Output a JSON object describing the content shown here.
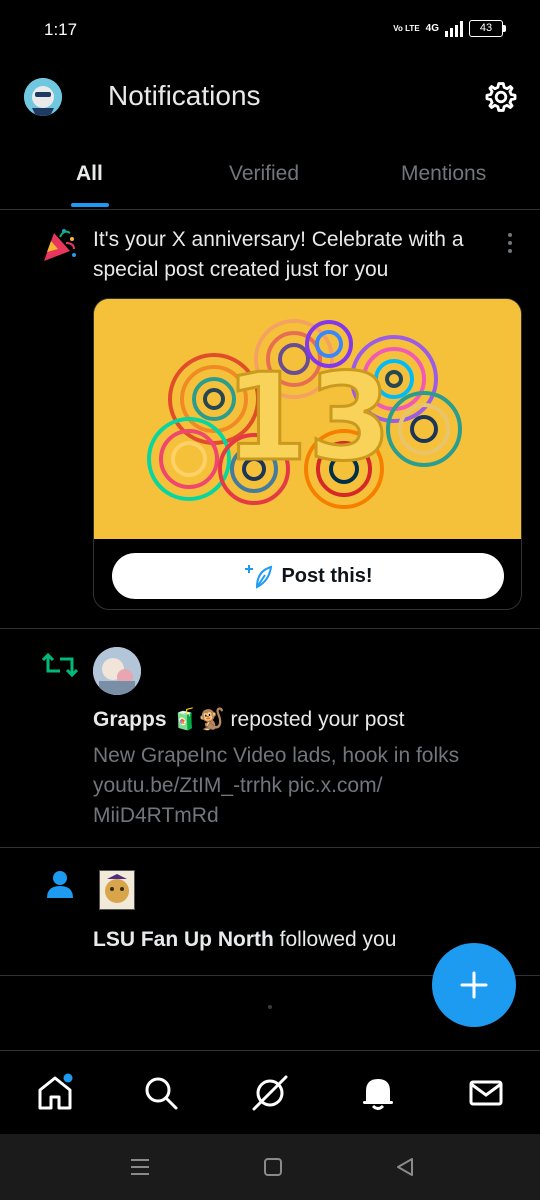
{
  "status_bar": {
    "time": "1:17",
    "volte": "Vo LTE",
    "network": "4G",
    "battery": "43"
  },
  "header": {
    "title": "Notifications"
  },
  "tabs": [
    {
      "label": "All",
      "active": true
    },
    {
      "label": "Verified",
      "active": false
    },
    {
      "label": "Mentions",
      "active": false
    }
  ],
  "anniversary": {
    "line1": "It's your X anniversary! Celebrate with a",
    "line2": "special post created just for you",
    "image_number": "13",
    "post_button": "Post this!"
  },
  "repost": {
    "user": "Grapps",
    "user_emoji": "🧃🐒",
    "action": "reposted your post",
    "post_lines": [
      "New GrapeInc Video lads, hook in folks",
      "youtu.be/ZtIM_-trrhk pic.x.com/",
      "MiiD4RTmRd"
    ]
  },
  "follow": {
    "user": "LSU Fan Up North",
    "action": "followed you"
  },
  "colors": {
    "accent": "#1d9bf0",
    "repost_green": "#00ba7c",
    "bg": "#000000",
    "muted": "#71767b"
  }
}
